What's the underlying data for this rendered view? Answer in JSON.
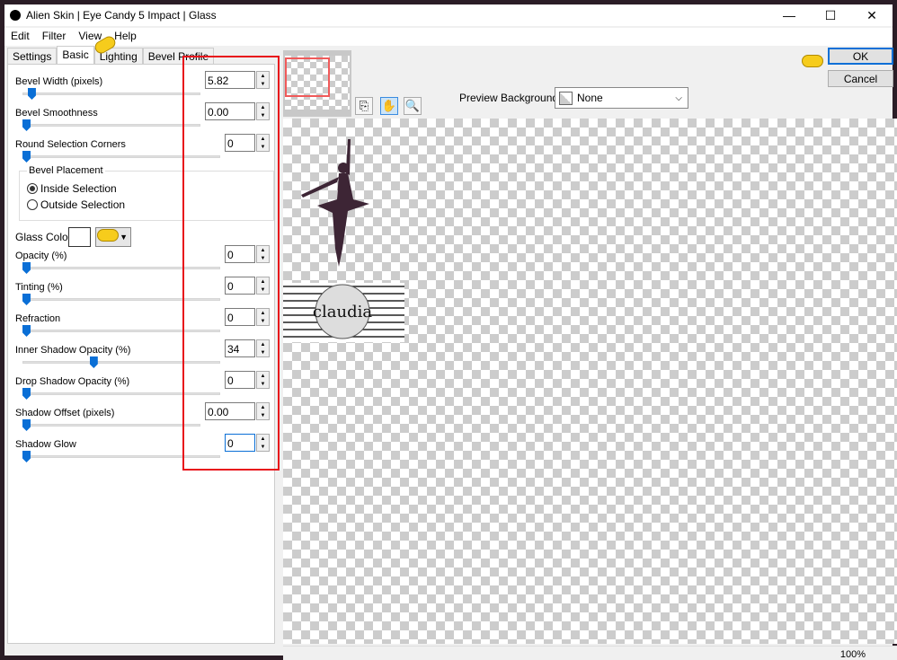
{
  "window": {
    "title": "Alien Skin | Eye Candy 5 Impact | Glass",
    "minimize": "—",
    "maximize": "☐",
    "close": "✕"
  },
  "menu": [
    "Edit",
    "Filter",
    "View",
    "Help"
  ],
  "tabs": [
    "Settings",
    "Basic",
    "Lighting",
    "Bevel Profile"
  ],
  "active_tab": "Basic",
  "controls": [
    {
      "label": "Bevel Width (pixels)",
      "value": "5.82",
      "level": 0.03
    },
    {
      "label": "Bevel Smoothness",
      "value": "0.00",
      "level": 0
    },
    {
      "label": "Round Selection Corners",
      "value": "0",
      "level": 0
    },
    {
      "label": "Opacity (%)",
      "value": "0",
      "level": 0
    },
    {
      "label": "Tinting (%)",
      "value": "0",
      "level": 0
    },
    {
      "label": "Refraction",
      "value": "0",
      "level": 0
    },
    {
      "label": "Inner Shadow Opacity (%)",
      "value": "34",
      "level": 0.34
    },
    {
      "label": "Drop Shadow Opacity (%)",
      "value": "0",
      "level": 0
    },
    {
      "label": "Shadow Offset (pixels)",
      "value": "0.00",
      "level": 0
    },
    {
      "label": "Shadow Glow",
      "value": "0",
      "level": 0
    }
  ],
  "bevel_placement": {
    "title": "Bevel Placement",
    "options": [
      "Inside Selection",
      "Outside Selection"
    ],
    "selected": "Inside Selection"
  },
  "glass_color": {
    "label": "Glass Color",
    "color": "#ffffff"
  },
  "preview": {
    "background_label": "Preview Background:",
    "background_value": "None",
    "watermark": "claudia",
    "zoom": "100%"
  },
  "buttons": {
    "ok": "OK",
    "cancel": "Cancel"
  },
  "colors": {
    "highlight": "#e8121b",
    "accent": "#0a6fd6"
  }
}
